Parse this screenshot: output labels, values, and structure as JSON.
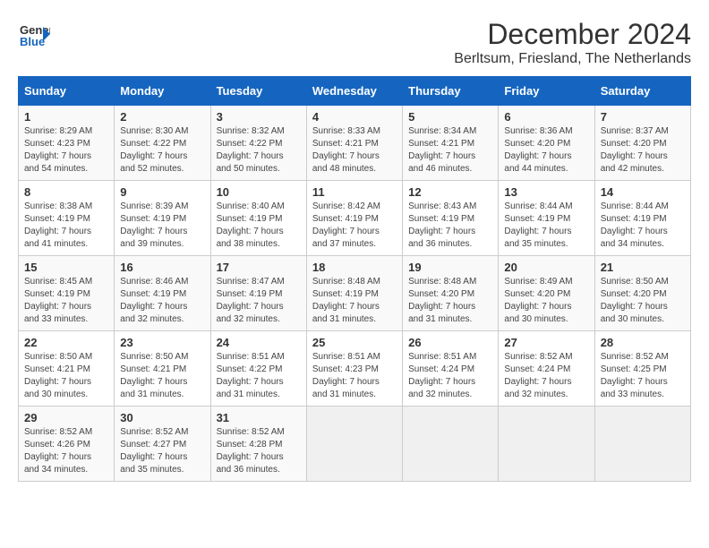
{
  "logo": {
    "line1": "General",
    "line2": "Blue"
  },
  "title": "December 2024",
  "subtitle": "Berltsum, Friesland, The Netherlands",
  "header": {
    "accent_color": "#1565c0"
  },
  "days_of_week": [
    "Sunday",
    "Monday",
    "Tuesday",
    "Wednesday",
    "Thursday",
    "Friday",
    "Saturday"
  ],
  "weeks": [
    [
      {
        "day": 1,
        "sunrise": "8:29 AM",
        "sunset": "4:23 PM",
        "daylight": "7 hours and 54 minutes."
      },
      {
        "day": 2,
        "sunrise": "8:30 AM",
        "sunset": "4:22 PM",
        "daylight": "7 hours and 52 minutes."
      },
      {
        "day": 3,
        "sunrise": "8:32 AM",
        "sunset": "4:22 PM",
        "daylight": "7 hours and 50 minutes."
      },
      {
        "day": 4,
        "sunrise": "8:33 AM",
        "sunset": "4:21 PM",
        "daylight": "7 hours and 48 minutes."
      },
      {
        "day": 5,
        "sunrise": "8:34 AM",
        "sunset": "4:21 PM",
        "daylight": "7 hours and 46 minutes."
      },
      {
        "day": 6,
        "sunrise": "8:36 AM",
        "sunset": "4:20 PM",
        "daylight": "7 hours and 44 minutes."
      },
      {
        "day": 7,
        "sunrise": "8:37 AM",
        "sunset": "4:20 PM",
        "daylight": "7 hours and 42 minutes."
      }
    ],
    [
      {
        "day": 8,
        "sunrise": "8:38 AM",
        "sunset": "4:19 PM",
        "daylight": "7 hours and 41 minutes."
      },
      {
        "day": 9,
        "sunrise": "8:39 AM",
        "sunset": "4:19 PM",
        "daylight": "7 hours and 39 minutes."
      },
      {
        "day": 10,
        "sunrise": "8:40 AM",
        "sunset": "4:19 PM",
        "daylight": "7 hours and 38 minutes."
      },
      {
        "day": 11,
        "sunrise": "8:42 AM",
        "sunset": "4:19 PM",
        "daylight": "7 hours and 37 minutes."
      },
      {
        "day": 12,
        "sunrise": "8:43 AM",
        "sunset": "4:19 PM",
        "daylight": "7 hours and 36 minutes."
      },
      {
        "day": 13,
        "sunrise": "8:44 AM",
        "sunset": "4:19 PM",
        "daylight": "7 hours and 35 minutes."
      },
      {
        "day": 14,
        "sunrise": "8:44 AM",
        "sunset": "4:19 PM",
        "daylight": "7 hours and 34 minutes."
      }
    ],
    [
      {
        "day": 15,
        "sunrise": "8:45 AM",
        "sunset": "4:19 PM",
        "daylight": "7 hours and 33 minutes."
      },
      {
        "day": 16,
        "sunrise": "8:46 AM",
        "sunset": "4:19 PM",
        "daylight": "7 hours and 32 minutes."
      },
      {
        "day": 17,
        "sunrise": "8:47 AM",
        "sunset": "4:19 PM",
        "daylight": "7 hours and 32 minutes."
      },
      {
        "day": 18,
        "sunrise": "8:48 AM",
        "sunset": "4:19 PM",
        "daylight": "7 hours and 31 minutes."
      },
      {
        "day": 19,
        "sunrise": "8:48 AM",
        "sunset": "4:20 PM",
        "daylight": "7 hours and 31 minutes."
      },
      {
        "day": 20,
        "sunrise": "8:49 AM",
        "sunset": "4:20 PM",
        "daylight": "7 hours and 30 minutes."
      },
      {
        "day": 21,
        "sunrise": "8:50 AM",
        "sunset": "4:20 PM",
        "daylight": "7 hours and 30 minutes."
      }
    ],
    [
      {
        "day": 22,
        "sunrise": "8:50 AM",
        "sunset": "4:21 PM",
        "daylight": "7 hours and 30 minutes."
      },
      {
        "day": 23,
        "sunrise": "8:50 AM",
        "sunset": "4:21 PM",
        "daylight": "7 hours and 31 minutes."
      },
      {
        "day": 24,
        "sunrise": "8:51 AM",
        "sunset": "4:22 PM",
        "daylight": "7 hours and 31 minutes."
      },
      {
        "day": 25,
        "sunrise": "8:51 AM",
        "sunset": "4:23 PM",
        "daylight": "7 hours and 31 minutes."
      },
      {
        "day": 26,
        "sunrise": "8:51 AM",
        "sunset": "4:24 PM",
        "daylight": "7 hours and 32 minutes."
      },
      {
        "day": 27,
        "sunrise": "8:52 AM",
        "sunset": "4:24 PM",
        "daylight": "7 hours and 32 minutes."
      },
      {
        "day": 28,
        "sunrise": "8:52 AM",
        "sunset": "4:25 PM",
        "daylight": "7 hours and 33 minutes."
      }
    ],
    [
      {
        "day": 29,
        "sunrise": "8:52 AM",
        "sunset": "4:26 PM",
        "daylight": "7 hours and 34 minutes."
      },
      {
        "day": 30,
        "sunrise": "8:52 AM",
        "sunset": "4:27 PM",
        "daylight": "7 hours and 35 minutes."
      },
      {
        "day": 31,
        "sunrise": "8:52 AM",
        "sunset": "4:28 PM",
        "daylight": "7 hours and 36 minutes."
      },
      null,
      null,
      null,
      null
    ]
  ]
}
